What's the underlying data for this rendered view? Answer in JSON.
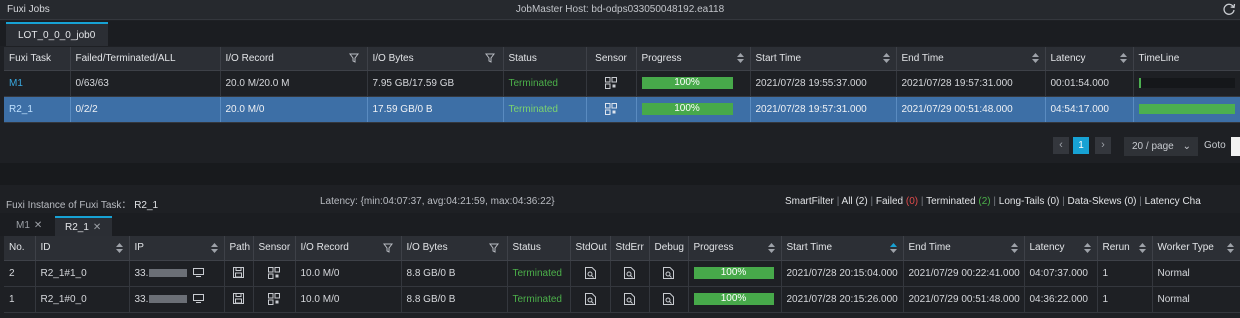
{
  "window": {
    "title": "Fuxi Jobs",
    "host": "JobMaster Host: bd-odps033050048192.ea118"
  },
  "job_tab": {
    "label": "LOT_0_0_0_job0"
  },
  "tasks_table": {
    "headers": [
      "Fuxi Task",
      "Failed/Terminated/ALL",
      "I/O Record",
      "I/O Bytes",
      "Status",
      "Sensor",
      "Progress",
      "Start Time",
      "End Time",
      "Latency",
      "TimeLine"
    ],
    "rows": [
      {
        "task": "M1",
        "fta": "0/63/63",
        "io_record": "20.0 M/20.0 M",
        "io_bytes": "7.95 GB/17.59 GB",
        "status": "Terminated",
        "progress": "100%",
        "progress_value": 1.0,
        "start": "2021/07/28 19:55:37.000",
        "end": "2021/07/28 19:57:31.000",
        "latency": "00:01:54.000",
        "timeline_fraction": 0.02
      },
      {
        "task": "R2_1",
        "fta": "0/2/2",
        "io_record": "20.0 M/0",
        "io_bytes": "17.59 GB/0 B",
        "status": "Terminated",
        "progress": "100%",
        "progress_value": 1.0,
        "start": "2021/07/28 19:57:31.000",
        "end": "2021/07/29 00:51:48.000",
        "latency": "04:54:17.000",
        "timeline_fraction": 1.0
      }
    ]
  },
  "pagination": {
    "current_page": "1",
    "page_size": "20 / page",
    "goto_label": "Goto"
  },
  "instance_bar": {
    "label": "Fuxi Instance of Fuxi Task：",
    "task": "R2_1",
    "latency_text": "Latency: {min:04:07:37, avg:04:21:59, max:04:36:22}",
    "smartfilter_label": "SmartFilter",
    "all_label": "All",
    "all_count": "(2)",
    "failed_label": "Failed",
    "failed_count": "(0)",
    "terminated_label": "Terminated",
    "terminated_count": "(2)",
    "longtails_label": "Long-Tails",
    "longtails_count": "(0)",
    "dataskews_label": "Data-Skews",
    "dataskews_count": "(0)",
    "latencychart_label": "Latency Cha"
  },
  "task_tabs": [
    {
      "label": "M1"
    },
    {
      "label": "R2_1"
    }
  ],
  "instances_table": {
    "headers": [
      "No.",
      "ID",
      "IP",
      "Path",
      "Sensor",
      "I/O Record",
      "I/O Bytes",
      "Status",
      "StdOut",
      "StdErr",
      "Debug",
      "Progress",
      "Start Time",
      "End Time",
      "Latency",
      "Rerun",
      "Worker Type"
    ],
    "rows": [
      {
        "no": "2",
        "id": "R2_1#1_0",
        "ip": "33.",
        "io_record": "10.0 M/0",
        "io_bytes": "8.8 GB/0 B",
        "status": "Terminated",
        "progress": "100%",
        "progress_value": 1.0,
        "start": "2021/07/28 20:15:04.000",
        "end": "2021/07/29 00:22:41.000",
        "latency": "04:07:37.000",
        "rerun": "1",
        "worker_type": "Normal"
      },
      {
        "no": "1",
        "id": "R2_1#0_0",
        "ip": "33.",
        "io_record": "10.0 M/0",
        "io_bytes": "8.8 GB/0 B",
        "status": "Terminated",
        "progress": "100%",
        "progress_value": 1.0,
        "start": "2021/07/28 20:15:26.000",
        "end": "2021/07/29 00:51:48.000",
        "latency": "04:36:22.000",
        "rerun": "1",
        "worker_type": "Normal"
      }
    ]
  },
  "colors": {
    "accent": "#17a2d4",
    "status_ok": "#4cb04a",
    "progress": "#47a94a",
    "selected_row": "#3d6fa6",
    "failed": "#e04b4b"
  }
}
